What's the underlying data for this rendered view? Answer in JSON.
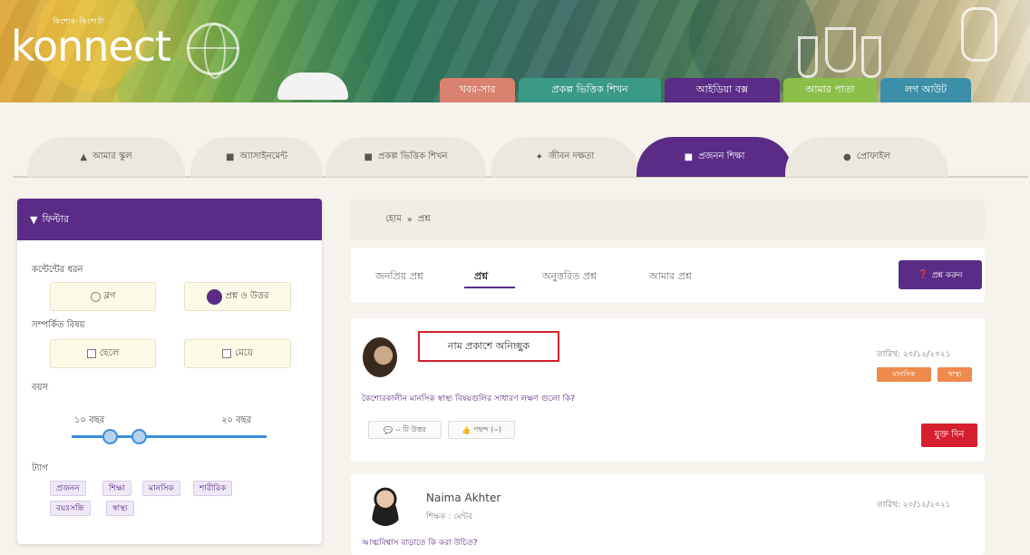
{
  "brand": {
    "logo": "konnect",
    "logo_tagline": "কিশোর-কিশোরী"
  },
  "topnav": [
    {
      "label": "খবর-সার",
      "color": "#d9826f"
    },
    {
      "label": "প্রকল্প ভিত্তিক শিখন",
      "color": "#3a9a86"
    },
    {
      "label": "আইডিয়া বক্স",
      "color": "#5a2c86"
    },
    {
      "label": "আমার পাতা",
      "color": "#8cbf4a"
    },
    {
      "label": "লগ আউট",
      "color": "#3b8fa8"
    }
  ],
  "tabs": [
    {
      "label": "আমার স্কুল",
      "icon": "school-icon"
    },
    {
      "label": "অ্যাসাইনমেন্ট",
      "icon": "assignment-icon"
    },
    {
      "label": "প্রকল্প ভিত্তিক শিখন",
      "icon": "project-icon"
    },
    {
      "label": "জীবন দক্ষতা",
      "icon": "life-skills-icon"
    },
    {
      "label": "প্রজনন শিক্ষা",
      "icon": "book-icon"
    },
    {
      "label": "প্রোফাইল",
      "icon": "profile-icon"
    }
  ],
  "filter": {
    "title": "ফিল্টার",
    "content_type_label": "কন্টেন্টের ধরন",
    "blog_label": "ব্লগ",
    "qa_label": "প্রশ্ন ও উত্তর",
    "related_label": "সম্পর্কিত বিষয়",
    "boy_label": "ছেলে",
    "girl_label": "মেয়ে",
    "age_label": "বয়স",
    "age_min": "১০ বছর",
    "age_max": "২০ বছর",
    "tags_label": "ট্যাগ",
    "tags": [
      "প্রজনন",
      "শিক্ষা",
      "মানসিক",
      "শারীরিক",
      "বয়ঃসন্ধি",
      "স্বাস্থ্য"
    ]
  },
  "breadcrumb": {
    "home": "হোম",
    "sep": "»",
    "current": "প্রশ্ন"
  },
  "qtabs": [
    "জনপ্রিয় প্রশ্ন",
    "প্রশ্ন",
    "অনুত্তরিত প্রশ্ন",
    "আমার প্রশ্ন"
  ],
  "ask_button": "প্রশ্ন করুন",
  "posts": [
    {
      "name": "নাম প্রকাশে অনিচ্ছুক",
      "date": "তারিখ: ২০/১২/২০২১",
      "badges": [
        {
          "label": "মানসিক",
          "color": "#ef8a4d"
        },
        {
          "label": "স্বাস্থ্য",
          "color": "#ef8a4d"
        }
      ],
      "question": "কৈশোরকালীন মানসিক স্বাস্থ্য বিষয়গুলির সাধারণ লক্ষণ গুলো কি?",
      "answer_count": "০ টি উত্তর",
      "likes": "পছন্দ (০)",
      "action": "যুক্ত দিন"
    },
    {
      "name": "Naima Akhter",
      "role": "শিক্ষক : মেন্টর",
      "date": "তারিখ: ২০/১২/২০২১",
      "question": "আত্মবিশ্বাস বাড়াতে কি করা উচিত?"
    }
  ]
}
